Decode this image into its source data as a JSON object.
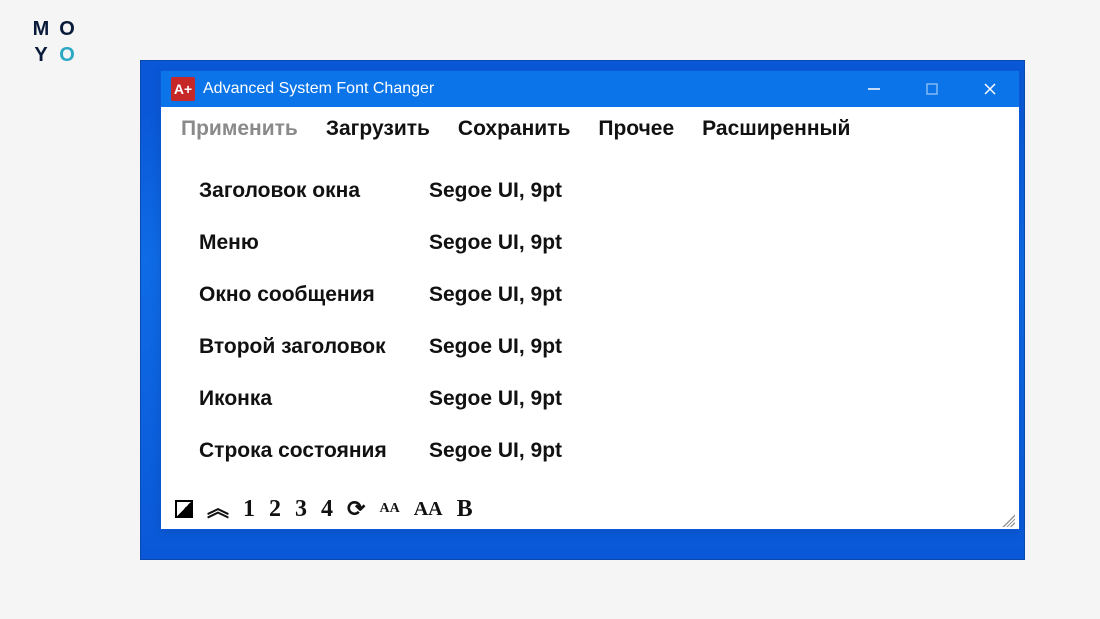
{
  "brand": {
    "m": "M",
    "o1": "O",
    "y": "Y",
    "o2": "O"
  },
  "window": {
    "title": "Advanced System Font Changer",
    "icon_text": "A+"
  },
  "menu": {
    "apply": "Применить",
    "load": "Загрузить",
    "save": "Сохранить",
    "other": "Прочее",
    "advanced": "Расширенный"
  },
  "rows": [
    {
      "label": "Заголовок окна",
      "value": "Segoe UI, 9pt"
    },
    {
      "label": "Меню",
      "value": "Segoe UI, 9pt"
    },
    {
      "label": "Окно сообщения",
      "value": "Segoe UI, 9pt"
    },
    {
      "label": "Второй заголовок",
      "value": "Segoe UI, 9pt"
    },
    {
      "label": "Иконка",
      "value": "Segoe UI, 9pt"
    },
    {
      "label": "Строка состояния",
      "value": "Segoe UI, 9pt"
    }
  ],
  "toolbar": {
    "presets": [
      "1",
      "2",
      "3",
      "4"
    ],
    "aa_small": "AA",
    "aa_large": "AA",
    "bold": "B"
  }
}
